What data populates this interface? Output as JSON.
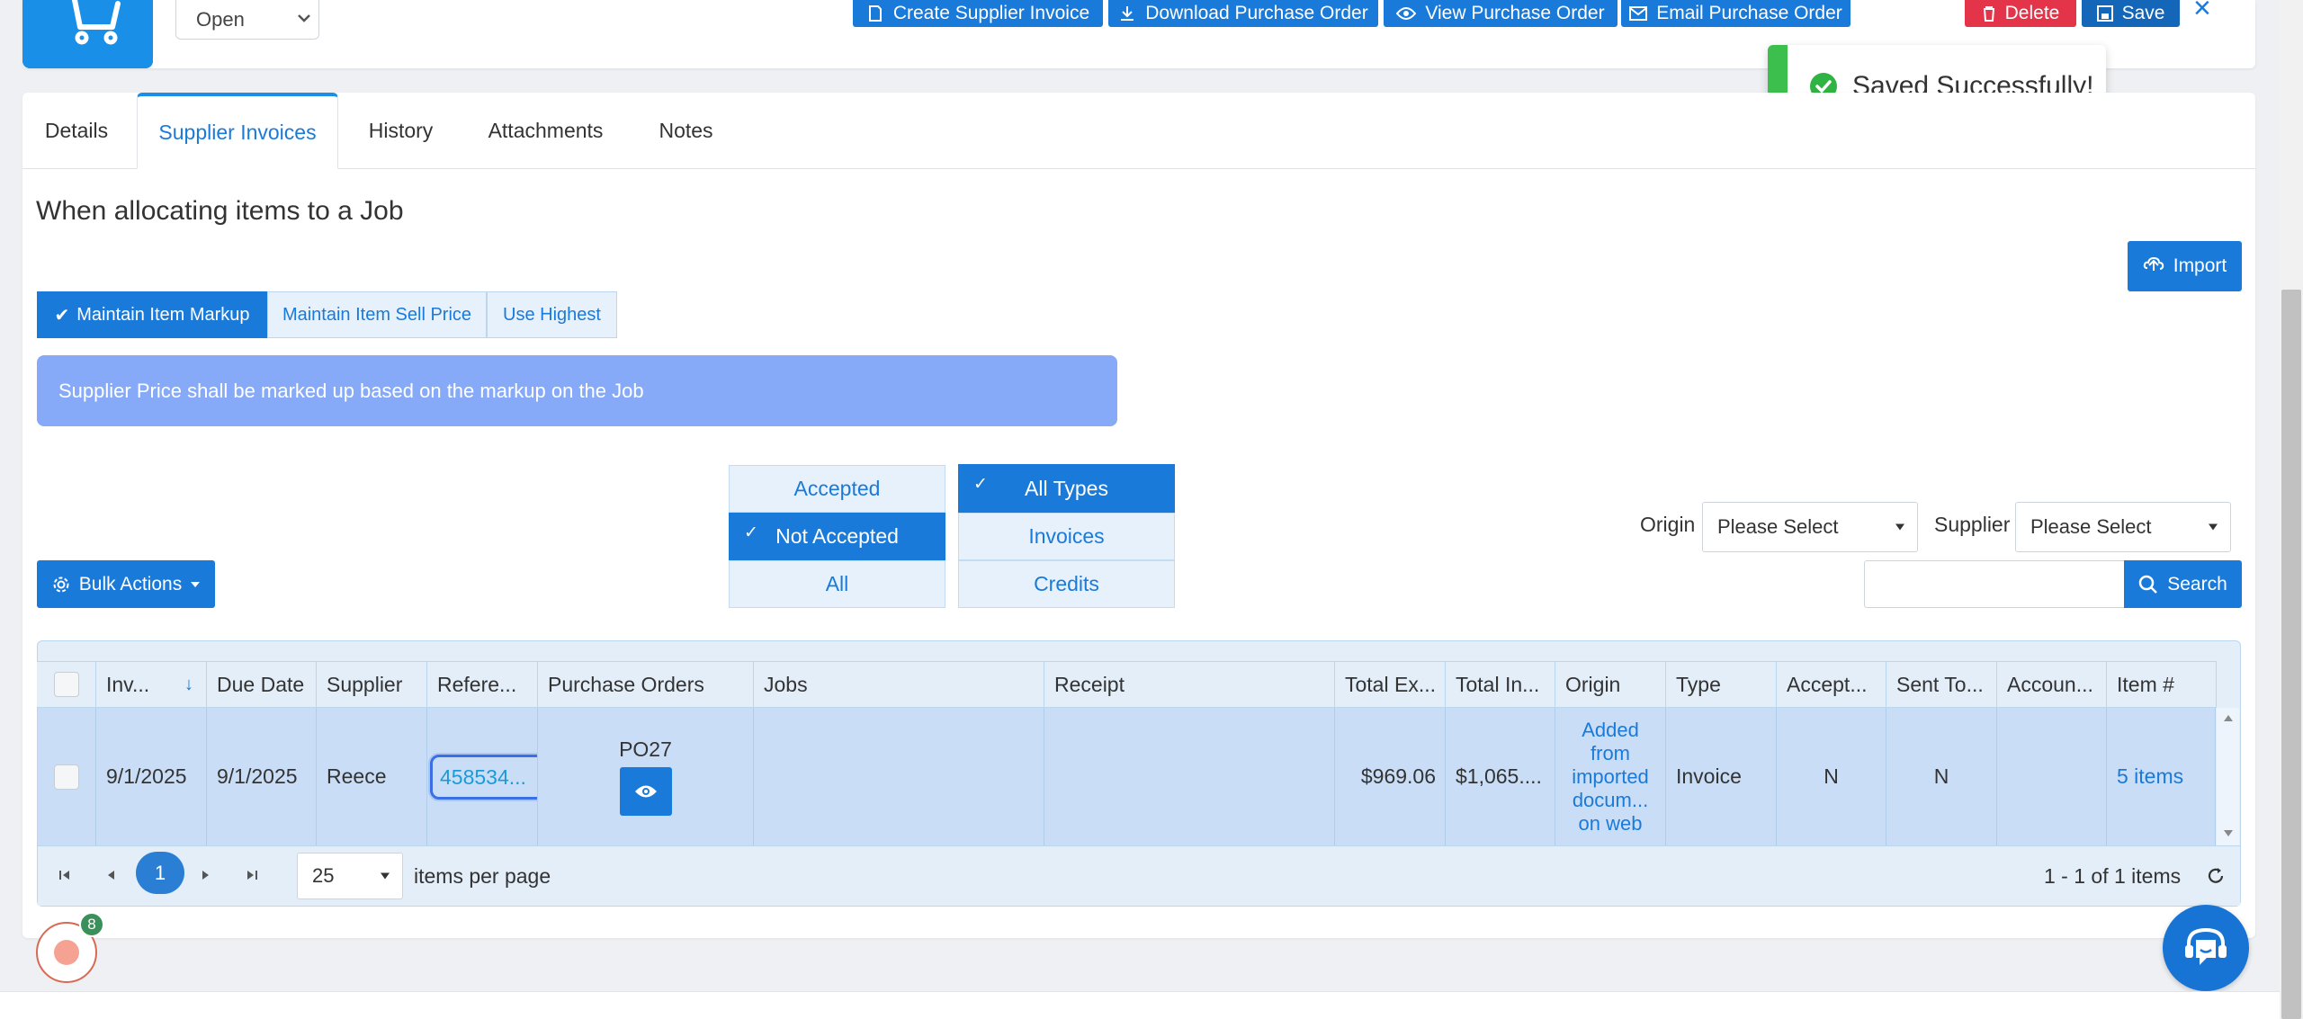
{
  "header": {
    "status_value": "Open",
    "actions": {
      "create_supplier_invoice": "Create Supplier Invoice",
      "download_purchase_order": "Download Purchase Order",
      "view_purchase_order": "View Purchase Order",
      "email_purchase_order": "Email Purchase Order",
      "delete": "Delete",
      "save": "Save",
      "close": "×"
    }
  },
  "toast": {
    "message": "Saved Successfully!"
  },
  "tabs": [
    {
      "label": "Details"
    },
    {
      "label": "Supplier Invoices"
    },
    {
      "label": "History"
    },
    {
      "label": "Attachments"
    },
    {
      "label": "Notes"
    }
  ],
  "allocation": {
    "title": "When allocating items to a Job",
    "import_label": "Import",
    "options": [
      {
        "label": "Maintain Item Markup"
      },
      {
        "label": "Maintain Item Sell Price"
      },
      {
        "label": "Use Highest"
      }
    ],
    "info": "Supplier Price shall be marked up based on the markup on the Job"
  },
  "filters": {
    "acceptance": [
      {
        "label": "Accepted"
      },
      {
        "label": "Not Accepted"
      },
      {
        "label": "All"
      }
    ],
    "types": [
      {
        "label": "All Types"
      },
      {
        "label": "Invoices"
      },
      {
        "label": "Credits"
      }
    ],
    "origin_label": "Origin",
    "origin_value": "Please Select",
    "supplier_label": "Supplier",
    "supplier_value": "Please Select",
    "search_label": "Search",
    "bulk_actions": "Bulk Actions"
  },
  "table": {
    "columns": [
      "Inv...",
      "Due Date",
      "Supplier",
      "Refere...",
      "Purchase Orders",
      "Jobs",
      "Receipt",
      "Total Ex...",
      "Total In...",
      "Origin",
      "Type",
      "Accept...",
      "Sent To...",
      "Accoun...",
      "Item #"
    ],
    "row": {
      "invoice_date": "9/1/2025",
      "due_date": "9/1/2025",
      "supplier": "Reece",
      "reference": "458534...",
      "purchase_order": "PO27",
      "jobs": "",
      "receipt": "",
      "total_ex": "$969.06",
      "total_inc": "$1,065....",
      "origin_lines": [
        "Added",
        "from",
        "imported",
        "docum...",
        "on web"
      ],
      "type": "Invoice",
      "accepted": "N",
      "sent_to": "N",
      "account": "",
      "items": "5 items"
    }
  },
  "pager": {
    "current_page": "1",
    "page_size": "25",
    "per_page_label": "items per page",
    "summary": "1 - 1 of 1 items"
  },
  "notifications": {
    "count": "8"
  },
  "colors": {
    "primary": "#1a7ad9",
    "danger": "#e3344a",
    "success": "#3cbf4d",
    "info_banner": "#86aaf7",
    "selected_row": "#c9def6"
  }
}
